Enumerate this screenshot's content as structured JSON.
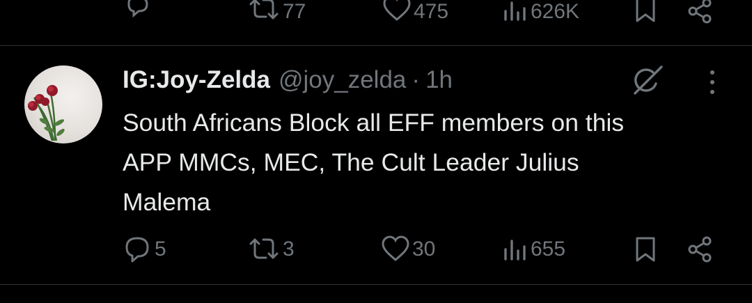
{
  "previous_tweet": {
    "reposts": "77",
    "likes": "475",
    "views": "626K"
  },
  "tweet": {
    "display_name": "IG:Joy-Zelda",
    "handle": "@joy_zelda",
    "separator": "·",
    "time": "1h",
    "text_lines": [
      "South Africans Block all EFF members on this",
      "APP MMCs, MEC, The Cult Leader Julius",
      "Malema"
    ],
    "replies": "5",
    "reposts": "3",
    "likes": "30",
    "views": "655"
  },
  "colors": {
    "background": "#000000",
    "text": "#e7e9ea",
    "muted": "#71767b",
    "divider": "#2f3336"
  },
  "icons": [
    "reply-icon",
    "repost-icon",
    "like-icon",
    "views-icon",
    "bookmark-icon",
    "share-icon",
    "grok-icon",
    "more-icon"
  ]
}
